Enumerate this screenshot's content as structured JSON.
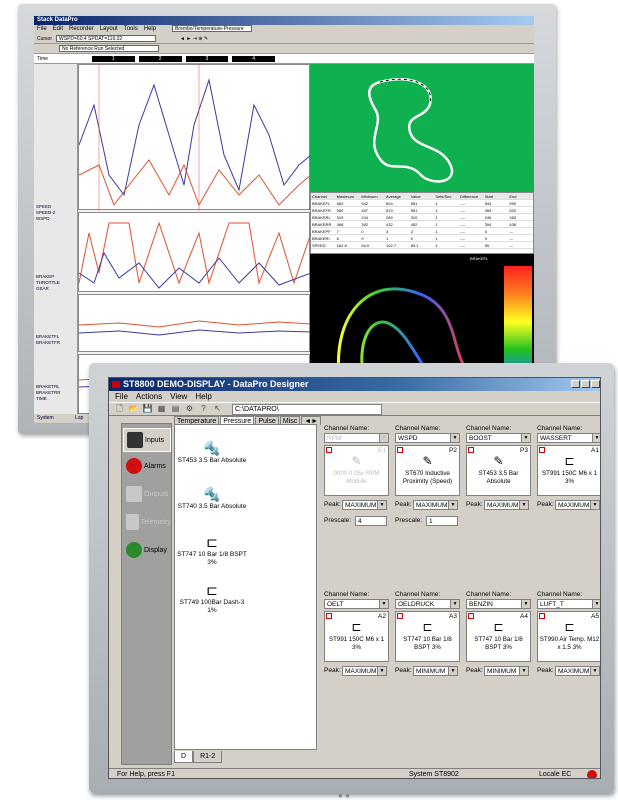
{
  "back": {
    "title": "Stack DataPro",
    "menu": [
      "File",
      "Edit",
      "Recorder",
      "Layout",
      "Tools",
      "Help"
    ],
    "toolbar_select": "Brembo/Temperature-Pressure",
    "cursor_label": "Cursor",
    "cursor_value": "WSPD=60.4 SPDAT=116.02",
    "sub_label": "No Reference Run Selected",
    "time_label": "Time",
    "status_left": "System",
    "status_mid": "Lap",
    "lap_ticks": [
      "1",
      "2",
      "3",
      "4"
    ],
    "table_headers": [
      "Channel",
      "Maximum",
      "Minimum",
      "Average",
      "Value",
      "Sets/Sec",
      "Difference",
      "Start",
      "End"
    ],
    "table_rows": [
      [
        "BRAKEFL",
        "683",
        "542",
        "604",
        "651",
        "1",
        "----",
        "544",
        "590"
      ],
      [
        "BRAKEFR",
        "550",
        "457",
        "519",
        "551",
        "1",
        "----",
        "459",
        "520"
      ],
      [
        "BRAKERL",
        "319",
        "244",
        "289",
        "310",
        "1",
        "----",
        "246",
        "283"
      ],
      [
        "BRAKERR",
        "468",
        "392",
        "432",
        "452",
        "1",
        "----",
        "394",
        "436"
      ],
      [
        "BRAKEPF",
        "7",
        "0",
        "3",
        "2",
        "1",
        "----",
        "0",
        "---"
      ],
      [
        "BRAKERI",
        "6",
        "0",
        "1",
        "0",
        "1",
        "----",
        "0",
        "---"
      ],
      [
        "SPEED",
        "162.8",
        "54.0",
        "102.7",
        "83.1",
        "1",
        "----",
        "55",
        "---"
      ]
    ],
    "map2_label": "BRAKEFL",
    "side_labels": [
      [
        "SPEED",
        "SPEED-2",
        "WSPD"
      ],
      [
        "BRAKEP",
        "THROTTLE",
        "GEAR"
      ],
      [
        "BRAKETFL",
        "BRAKETFR"
      ],
      [
        "BRAKETRL",
        "BRAKETRR",
        "TIME"
      ]
    ]
  },
  "front": {
    "title": "ST8800 DEMO-DISPLAY - DataPro Designer",
    "menu": [
      "File",
      "Actions",
      "View",
      "Help"
    ],
    "path": "C:\\DATAPRO\\",
    "nav": [
      {
        "label": "Inputs",
        "enabled": true
      },
      {
        "label": "Alarms",
        "enabled": true
      },
      {
        "label": "Outputs",
        "enabled": false
      },
      {
        "label": "Telemetry",
        "enabled": false
      },
      {
        "label": "Display",
        "enabled": true
      }
    ],
    "tabs": [
      "Temperature",
      "Pressure",
      "Pulse",
      "Misc"
    ],
    "active_tab": "Pressure",
    "palette": [
      {
        "name": "ST453 3.5 Bar Absolute",
        "icon": "pressure-sensor-icon"
      },
      {
        "name": "ST740 3.5 Bar Absolute",
        "icon": "pressure-sensor-icon"
      },
      {
        "name": "ST747 10 Bar 1/8 BSPT 3%",
        "icon": "connector-icon"
      },
      {
        "name": "ST749 100Bar Dash-3 1%",
        "icon": "connector-icon"
      }
    ],
    "bottom_tabs": [
      "D",
      "R1-2"
    ],
    "channel_label": "Channel Name:",
    "peak_label": "Peak:",
    "prescale_label": "Prescale:",
    "row1": [
      {
        "channel": "RPM",
        "code": "E1",
        "sensor": "0000 0.05x RPM Module",
        "enabled": false,
        "peak": "MAXIMUM",
        "prescale": "4"
      },
      {
        "channel": "WSPD",
        "code": "P2",
        "sensor": "ST670 Inductive Proximity (Speed)",
        "enabled": true,
        "peak": "MAXIMUM",
        "prescale": "1"
      },
      {
        "channel": "BOOST",
        "code": "P3",
        "sensor": "ST453 3.5 Bar Absolute",
        "enabled": true,
        "peak": "MAXIMUM",
        "prescale": ""
      },
      {
        "channel": "WASSERT",
        "code": "A1",
        "sensor": "ST991 150C M6 x 1 3%",
        "enabled": true,
        "peak": "MAXIMUM",
        "prescale": ""
      }
    ],
    "row2": [
      {
        "channel": "OELT",
        "code": "A2",
        "sensor": "ST991 150C M6 x 1 3%",
        "enabled": true,
        "peak": "MAXIMUM"
      },
      {
        "channel": "OELDRUCK",
        "code": "A3",
        "sensor": "ST747 10 Bar 1/8 BSPT 3%",
        "enabled": true,
        "peak": "MINIMUM"
      },
      {
        "channel": "BENZIN",
        "code": "A4",
        "sensor": "ST747 10 Bar 1/8 BSPT 3%",
        "enabled": true,
        "peak": "MINIMUM"
      },
      {
        "channel": "LUFT_T",
        "code": "A5",
        "sensor": "ST990 Air Temp. M12 x 1.5 3%",
        "enabled": true,
        "peak": "MAXIMUM"
      }
    ],
    "status": {
      "help": "For Help, press F1",
      "system": "System  ST8902",
      "locale": "Locale  EC"
    }
  },
  "colors": {
    "title": "#0a246a",
    "track_bg": "#0fb050",
    "alarm": "#cc0000"
  }
}
